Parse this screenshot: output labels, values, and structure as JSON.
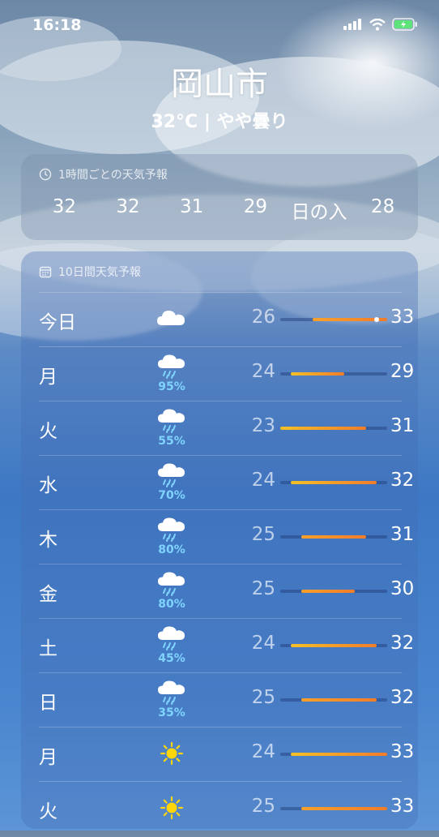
{
  "status": {
    "time": "16:18"
  },
  "header": {
    "city": "岡山市",
    "condition": "32°C | やや曇り"
  },
  "hourly": {
    "title": "1時間ごとの天気予報",
    "items": [
      "32",
      "32",
      "31",
      "29",
      "日の入",
      "28"
    ]
  },
  "daily": {
    "title": "10日間天気予報",
    "scale": {
      "min": 23,
      "max": 33
    },
    "days": [
      {
        "day": "今日",
        "icon": "cloud-icon",
        "pct": "",
        "lo": "26",
        "hi": "33",
        "current": 32
      },
      {
        "day": "月",
        "icon": "rain-cloud-icon",
        "pct": "95%",
        "lo": "24",
        "hi": "29"
      },
      {
        "day": "火",
        "icon": "rain-cloud-icon",
        "pct": "55%",
        "lo": "23",
        "hi": "31"
      },
      {
        "day": "水",
        "icon": "rain-cloud-icon",
        "pct": "70%",
        "lo": "24",
        "hi": "32"
      },
      {
        "day": "木",
        "icon": "rain-cloud-icon",
        "pct": "80%",
        "lo": "25",
        "hi": "31"
      },
      {
        "day": "金",
        "icon": "rain-cloud-icon",
        "pct": "80%",
        "lo": "25",
        "hi": "30"
      },
      {
        "day": "土",
        "icon": "rain-cloud-icon",
        "pct": "45%",
        "lo": "24",
        "hi": "32"
      },
      {
        "day": "日",
        "icon": "rain-cloud-icon",
        "pct": "35%",
        "lo": "25",
        "hi": "32"
      },
      {
        "day": "月",
        "icon": "sun-icon",
        "pct": "",
        "lo": "24",
        "hi": "33"
      },
      {
        "day": "火",
        "icon": "sun-icon",
        "pct": "",
        "lo": "25",
        "hi": "33"
      }
    ]
  },
  "colors": {
    "pct": "#7fd4ff",
    "bar_cool": "#f5c026",
    "bar_warm": "#f27c2a"
  }
}
